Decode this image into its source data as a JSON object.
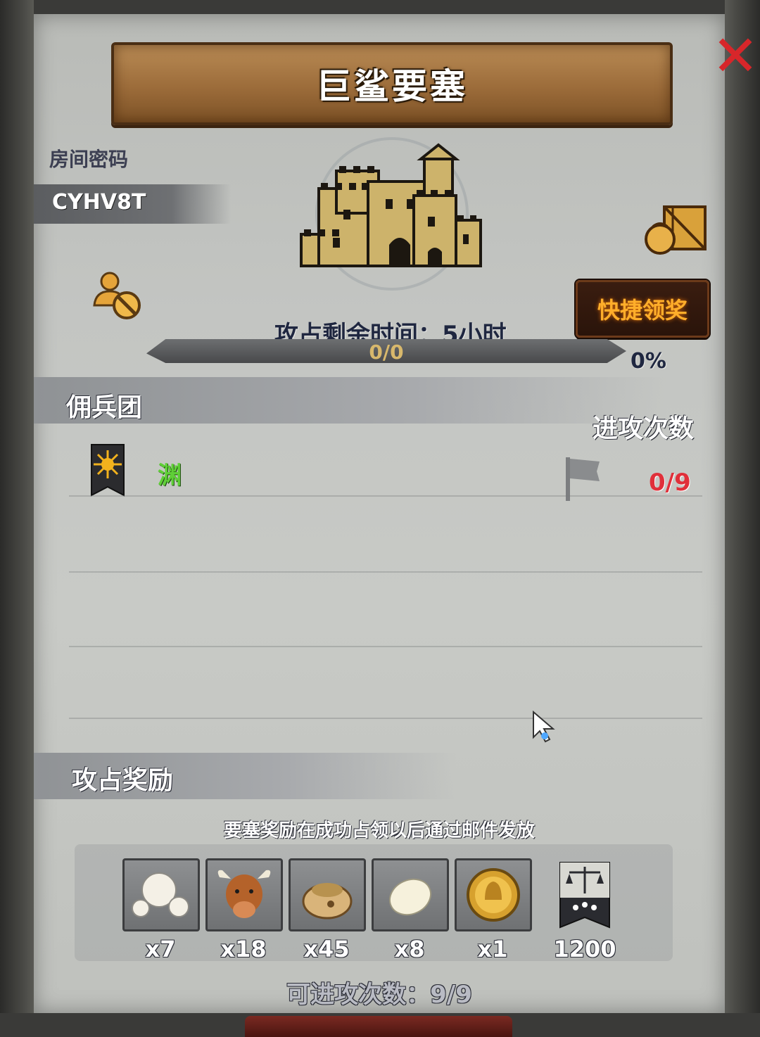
{
  "window": {
    "title": "巨鲨要塞",
    "close_symbol": "✕"
  },
  "room": {
    "label": "房间密码",
    "code": "CYHV8T"
  },
  "buttons": {
    "quick_claim": "快捷领奖"
  },
  "capture": {
    "remaining_label": "攻占剩余时间：5小时",
    "progress_text": "0/0",
    "progress_percent_text": "0%",
    "progress_fraction": 0
  },
  "mercenaries": {
    "section_title": "佣兵团",
    "attack_count_header": "进攻次数",
    "rows": [
      {
        "name": "渊",
        "attacks": "0/9"
      }
    ]
  },
  "rewards": {
    "section_title": "攻占奖励",
    "note": "要塞奖励在成功占领以后通过邮件发放",
    "items": [
      {
        "icon": "pearls-icon",
        "count": "x7"
      },
      {
        "icon": "ox-icon",
        "count": "x18"
      },
      {
        "icon": "sack-icon",
        "count": "x45"
      },
      {
        "icon": "egg-icon",
        "count": "x8"
      },
      {
        "icon": "gold-medal-icon",
        "count": "x1"
      }
    ],
    "points": {
      "icon": "scales-banner-icon",
      "value": "1200"
    }
  },
  "footer": {
    "available_attacks": "可进攻次数：9/9"
  },
  "colors": {
    "panel": "#c3c5c2",
    "title_banner": "#9c6c3a",
    "accent_orange": "#ffae2a",
    "mercenary_green": "#5fcf37",
    "attack_red": "#e0303a",
    "close_red": "#d8262a"
  }
}
